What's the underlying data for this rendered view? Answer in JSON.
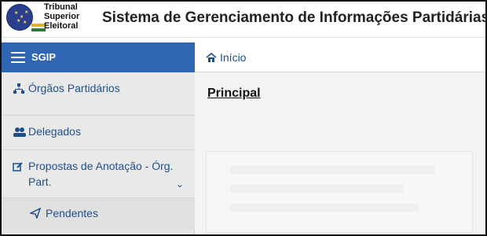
{
  "header": {
    "logo": {
      "line1": "Tribunal",
      "line2": "Superior",
      "line3": "Eleitoral"
    },
    "title": "Sistema de Gerenciamento de Informações Partidárias"
  },
  "sidebar": {
    "brand": "SGIP",
    "items": [
      {
        "label": "Órgãos Partidários",
        "icon": "sitemap-icon"
      },
      {
        "label": "Delegados",
        "icon": "users-icon"
      },
      {
        "label": "Propostas de Anotação - Órg. Part.",
        "icon": "edit-icon",
        "expanded": true
      },
      {
        "label": "Pendentes",
        "icon": "send-icon"
      }
    ]
  },
  "breadcrumb": {
    "label": "Início",
    "icon": "home-icon"
  },
  "main": {
    "page_title": "Principal"
  },
  "colors": {
    "primary": "#2f66b3",
    "link": "#1f4f8a",
    "sidebar_bg": "#e6e6e6"
  }
}
